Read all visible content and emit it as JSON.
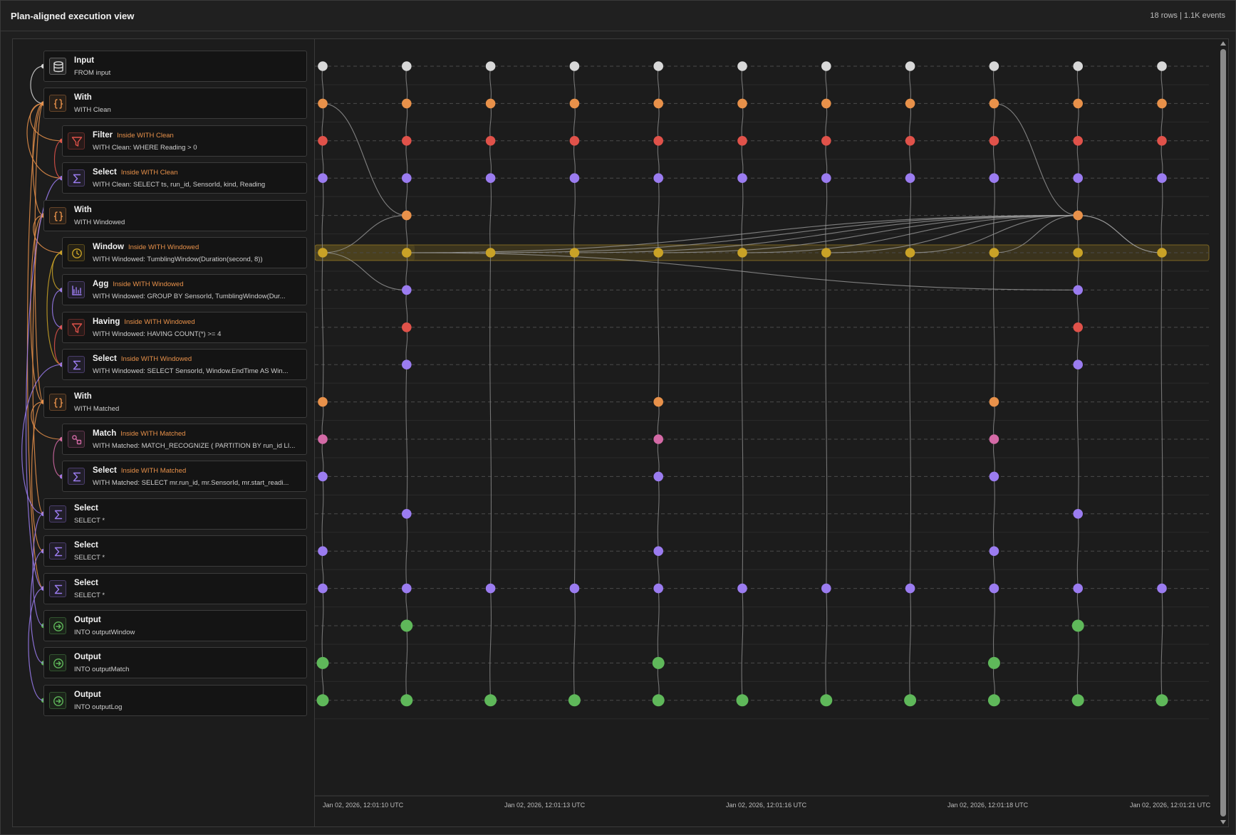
{
  "header": {
    "title": "Plan-aligned execution view",
    "stats": "18 rows | 1.1K events"
  },
  "colors": {
    "input": "#d8d8d8",
    "with": "#e8914a",
    "filter": "#e0524a",
    "select": "#9b7cf0",
    "window": "#c9a227",
    "agg": "#9b7cf0",
    "match": "#d46aa6",
    "output": "#5fb85a",
    "tag": "#e8914a"
  },
  "nodes": [
    {
      "title": "Input",
      "tag": "",
      "sub": "FROM input",
      "kind": "input",
      "icon": "database-icon"
    },
    {
      "title": "With",
      "tag": "",
      "sub": "WITH Clean",
      "kind": "with",
      "icon": "braces-icon"
    },
    {
      "title": "Filter",
      "tag": "Inside WITH Clean",
      "sub": "WITH Clean: WHERE Reading > 0",
      "kind": "filter",
      "icon": "funnel-icon"
    },
    {
      "title": "Select",
      "tag": "Inside WITH Clean",
      "sub": "WITH Clean: SELECT ts, run_id, SensorId, kind, Reading",
      "kind": "select",
      "icon": "sigma-icon"
    },
    {
      "title": "With",
      "tag": "",
      "sub": "WITH Windowed",
      "kind": "with",
      "icon": "braces-icon"
    },
    {
      "title": "Window",
      "tag": "Inside WITH Windowed",
      "sub": "WITH Windowed: TumblingWindow(Duration(second, 8))",
      "kind": "window",
      "icon": "clock-icon"
    },
    {
      "title": "Agg",
      "tag": "Inside WITH Windowed",
      "sub": "WITH Windowed: GROUP BY SensorId, TumblingWindow(Dur...",
      "kind": "agg",
      "icon": "bar-chart-icon"
    },
    {
      "title": "Having",
      "tag": "Inside WITH Windowed",
      "sub": "WITH Windowed: HAVING COUNT(*) >= 4",
      "kind": "filter",
      "icon": "funnel-icon"
    },
    {
      "title": "Select",
      "tag": "Inside WITH Windowed",
      "sub": "WITH Windowed: SELECT SensorId, Window.EndTime AS Win...",
      "kind": "select",
      "icon": "sigma-icon"
    },
    {
      "title": "With",
      "tag": "",
      "sub": "WITH Matched",
      "kind": "with",
      "icon": "braces-icon"
    },
    {
      "title": "Match",
      "tag": "Inside WITH Matched",
      "sub": "WITH Matched: MATCH_RECOGNIZE ( PARTITION BY run_id LI...",
      "kind": "match",
      "icon": "match-icon"
    },
    {
      "title": "Select",
      "tag": "Inside WITH Matched",
      "sub": "WITH Matched: SELECT mr.run_id, mr.SensorId, mr.start_readi...",
      "kind": "select",
      "icon": "sigma-icon"
    },
    {
      "title": "Select",
      "tag": "",
      "sub": "SELECT *",
      "kind": "select",
      "icon": "sigma-icon"
    },
    {
      "title": "Select",
      "tag": "",
      "sub": "SELECT *",
      "kind": "select",
      "icon": "sigma-icon"
    },
    {
      "title": "Select",
      "tag": "",
      "sub": "SELECT *",
      "kind": "select",
      "icon": "sigma-icon"
    },
    {
      "title": "Output",
      "tag": "",
      "sub": "INTO outputWindow",
      "kind": "output",
      "icon": "arrow-circle-icon"
    },
    {
      "title": "Output",
      "tag": "",
      "sub": "INTO outputMatch",
      "kind": "output",
      "icon": "arrow-circle-icon"
    },
    {
      "title": "Output",
      "tag": "",
      "sub": "INTO outputLog",
      "kind": "output",
      "icon": "arrow-circle-icon"
    }
  ],
  "timeline": {
    "highlighted_row": 5,
    "x_labels": [
      "Jan 02, 2026, 12:01:10 UTC",
      "Jan 02, 2026, 12:01:13 UTC",
      "Jan 02, 2026, 12:01:16 UTC",
      "Jan 02, 2026, 12:01:18 UTC",
      "Jan 02, 2026, 12:01:21 UTC"
    ],
    "events": {
      "all11": [
        0,
        1,
        2,
        3,
        4,
        5,
        6,
        7,
        8,
        9,
        10
      ],
      "row4": [
        1,
        9
      ],
      "row6_8": [
        1,
        9
      ],
      "row9_11": [
        0,
        4,
        8
      ],
      "row12": [
        1,
        9
      ],
      "row13": [
        0,
        4,
        8
      ],
      "row15": [
        1,
        9
      ],
      "row16": [
        0,
        4,
        8
      ]
    }
  }
}
